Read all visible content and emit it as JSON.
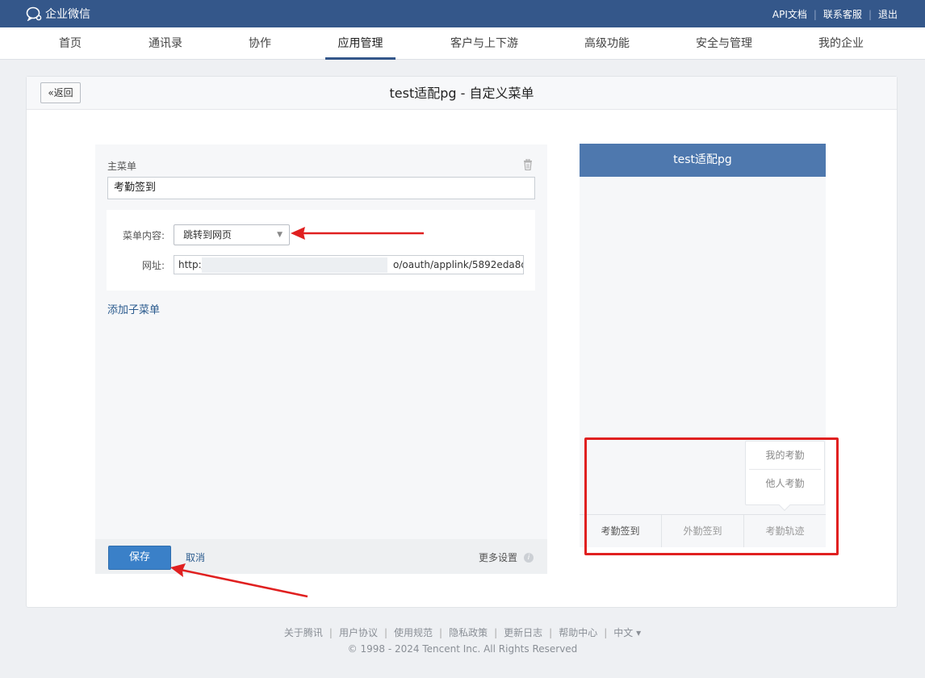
{
  "brand": {
    "name": "企业微信"
  },
  "top_links": [
    "API文档",
    "联系客服",
    "退出"
  ],
  "nav": {
    "items": [
      {
        "label": "首页"
      },
      {
        "label": "通讯录"
      },
      {
        "label": "协作"
      },
      {
        "label": "应用管理"
      },
      {
        "label": "客户与上下游"
      },
      {
        "label": "高级功能"
      },
      {
        "label": "安全与管理"
      },
      {
        "label": "我的企业"
      }
    ],
    "active": "应用管理"
  },
  "card": {
    "back_label": "返回",
    "title": "test适配pg - 自定义菜单"
  },
  "editor": {
    "main_menu_label": "主菜单",
    "main_menu_value": "考勤签到",
    "content_label": "菜单内容:",
    "content_select": "跳转到网页",
    "url_label": "网址:",
    "url_prefix": "http:/",
    "url_suffix": "o/oauth/applink/5892eda8d",
    "add_submenu": "添加子菜单",
    "save": "保存",
    "cancel": "取消",
    "more_settings": "更多设置"
  },
  "preview": {
    "title": "test适配pg",
    "tabs": [
      "考勤签到",
      "外勤签到",
      "考勤轨迹"
    ],
    "popup_items": [
      "我的考勤",
      "他人考勤"
    ]
  },
  "footer": {
    "links": [
      "关于腾讯",
      "用户协议",
      "使用规范",
      "隐私政策",
      "更新日志",
      "帮助中心",
      "中文 ▾"
    ],
    "copyright": "© 1998 - 2024 Tencent Inc. All Rights Reserved"
  },
  "colors": {
    "topbar": "#34578a",
    "preview_header": "#4e78ae",
    "primary_button": "#3a80c8",
    "annotation": "#e02020"
  }
}
